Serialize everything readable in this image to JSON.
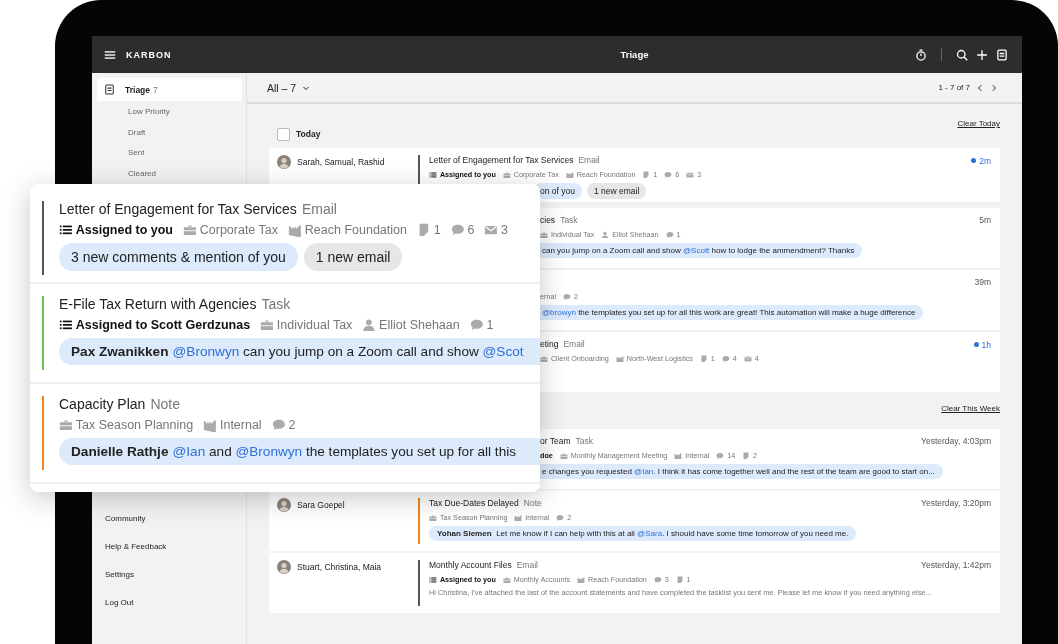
{
  "topbar": {
    "brand": "KARBON",
    "title": "Triage"
  },
  "sidebar": {
    "items": [
      {
        "label": "Triage",
        "count": "7",
        "selected": true,
        "children": [
          {
            "label": "Low Priority",
            "selected": false
          },
          {
            "label": "Draft",
            "selected": false
          },
          {
            "label": "Sent",
            "selected": false
          },
          {
            "label": "Cleared",
            "selected": false
          }
        ]
      }
    ],
    "footer": [
      {
        "label": "Community"
      },
      {
        "label": "Help & Feedback"
      },
      {
        "label": "Settings"
      },
      {
        "label": "Log Out"
      }
    ]
  },
  "toolbar": {
    "filter": "All – 7",
    "pagination": "1 - 7 of 7"
  },
  "sections": [
    {
      "title": "Today",
      "checked": false,
      "clear": "Clear Today",
      "rows": [
        {
          "sender": "Sarah, Samual, Rashid",
          "title": "Letter of Engagement for Tax Services",
          "type": "Email",
          "time": "2m",
          "unread": true,
          "color": "#555555",
          "meta": [
            {
              "kind": "assignee",
              "text": "Assigned to you"
            },
            {
              "kind": "work",
              "text": "Corporate Tax"
            },
            {
              "kind": "client",
              "text": "Reach Foundation"
            },
            {
              "kind": "notes",
              "text": "1"
            },
            {
              "kind": "comments",
              "text": "6"
            },
            {
              "kind": "emails",
              "text": "3"
            }
          ],
          "pills": [
            {
              "kind": "mention",
              "text": "on of you"
            },
            {
              "kind": "email",
              "text": "1 new email"
            }
          ]
        },
        {
          "title": "cies",
          "type": "Task",
          "time": "5m",
          "unread": false,
          "meta": [
            {
              "kind": "work",
              "text": "Individual Tax"
            },
            {
              "kind": "contact",
              "text": "Elliot Shehaan"
            },
            {
              "kind": "comments",
              "text": "1"
            }
          ],
          "message": [
            {
              "kind": "text",
              "text": "can you jump on a Zoom call and show "
            },
            {
              "kind": "mention",
              "text": "@Scott"
            },
            {
              "kind": "text",
              "text": " how to lodge the ammendment? Thanks"
            }
          ]
        },
        {
          "time": "39m",
          "unread": false,
          "meta": [
            {
              "kind": "client_part",
              "text": "ernal"
            },
            {
              "kind": "comments",
              "text": "2"
            }
          ],
          "message": [
            {
              "kind": "mention",
              "text": "@browyn"
            },
            {
              "kind": "text",
              "text": " the templates you set up for all this work are great! This automation will make a huge difference"
            }
          ]
        },
        {
          "title": "eting",
          "type": "Email",
          "time": "1h",
          "unread": true,
          "meta": [
            {
              "kind": "work",
              "text": "Client Onboarding"
            },
            {
              "kind": "client",
              "text": "North-West Logistics"
            },
            {
              "kind": "notes",
              "text": "1"
            },
            {
              "kind": "comments",
              "text": "4"
            },
            {
              "kind": "emails",
              "text": "4"
            }
          ]
        }
      ]
    },
    {
      "clear": "Clear This Week",
      "rows": [
        {
          "title": "or Team",
          "type": "Task",
          "time": "Yesterday, 4:03pm",
          "unread": false,
          "meta": [
            {
              "kind": "assignee_part",
              "text": "doe"
            },
            {
              "kind": "work",
              "text": "Monthly Management Meeting"
            },
            {
              "kind": "client",
              "text": "Internal"
            },
            {
              "kind": "comments",
              "text": "14"
            },
            {
              "kind": "notes",
              "text": "2"
            }
          ],
          "message": [
            {
              "kind": "text",
              "text": "e changes you requested "
            },
            {
              "kind": "mention",
              "text": "@Ian"
            },
            {
              "kind": "text",
              "text": ". I think it has come together well and the rest of the team are good to start on..."
            }
          ]
        },
        {
          "sender": "Sara Goepel",
          "title": "Tax Due-Dates Delayed",
          "type": "Note",
          "time": "Yesterday, 3:20pm",
          "unread": false,
          "color": "#f0851e",
          "meta": [
            {
              "kind": "work",
              "text": "Tax Season Planning"
            },
            {
              "kind": "client",
              "text": "Internal"
            },
            {
              "kind": "comments",
              "text": "2"
            }
          ],
          "message": [
            {
              "kind": "name",
              "text": "Yohan Siemen"
            },
            {
              "kind": "text",
              "text": " Let me know if I can help with this at all "
            },
            {
              "kind": "mention",
              "text": "@Sara"
            },
            {
              "kind": "text",
              "text": ". I should have some time tomorrow of you need me."
            }
          ]
        },
        {
          "sender": "Stuart, Christina, Maia",
          "title": "Monthly Account Files",
          "type": "Email",
          "time": "Yesterday, 1:42pm",
          "unread": false,
          "color": "#555555",
          "meta": [
            {
              "kind": "assignee",
              "text": "Assigned to you"
            },
            {
              "kind": "work",
              "text": "Monthly Accounts"
            },
            {
              "kind": "client",
              "text": "Reach Foundation"
            },
            {
              "kind": "comments",
              "text": "3"
            },
            {
              "kind": "notes",
              "text": "1"
            }
          ],
          "preview": "Hi Christina, I've attached the last of the account statements and have completed the tasklist you sent me. Please let me know if you need anything else..."
        }
      ]
    }
  ],
  "card": {
    "items": [
      {
        "title": "Letter of Engagement for Tax Services",
        "type": "Email",
        "color": "#555555",
        "meta": [
          {
            "kind": "assignee",
            "text": "Assigned to you"
          },
          {
            "kind": "work",
            "text": "Corporate Tax"
          },
          {
            "kind": "client",
            "text": "Reach Foundation"
          },
          {
            "kind": "notes",
            "text": "1"
          },
          {
            "kind": "comments",
            "text": "6"
          },
          {
            "kind": "emails",
            "text": "3"
          }
        ],
        "pills": [
          {
            "kind": "mention",
            "text": "3 new comments & mention of you"
          },
          {
            "kind": "email",
            "text": "1 new email"
          }
        ]
      },
      {
        "title": "E-File Tax Return with Agencies",
        "type": "Task",
        "color": "#6cc04a",
        "meta": [
          {
            "kind": "assignee",
            "text": "Assigned to Scott Gerdzunas"
          },
          {
            "kind": "work",
            "text": "Individual Tax"
          },
          {
            "kind": "contact",
            "text": "Elliot Shehaan"
          },
          {
            "kind": "comments",
            "text": "1"
          }
        ],
        "message": [
          {
            "kind": "name",
            "text": "Pax Zwanikken"
          },
          {
            "kind": "mention",
            "text": "@Bronwyn"
          },
          {
            "kind": "text",
            "text": " can you jump on a Zoom call and show "
          },
          {
            "kind": "mention",
            "text": "@Scot"
          }
        ]
      },
      {
        "title": "Capacity Plan",
        "type": "Note",
        "color": "#f0851e",
        "meta": [
          {
            "kind": "work",
            "text": "Tax Season Planning"
          },
          {
            "kind": "client",
            "text": "Internal"
          },
          {
            "kind": "comments",
            "text": "2"
          }
        ],
        "message": [
          {
            "kind": "name",
            "text": "Danielle Rathje"
          },
          {
            "kind": "mention",
            "text": "@Ian"
          },
          {
            "kind": "text",
            "text": " and "
          },
          {
            "kind": "mention",
            "text": "@Bronwyn"
          },
          {
            "kind": "text",
            "text": " the templates you set up for all this"
          }
        ]
      }
    ]
  }
}
